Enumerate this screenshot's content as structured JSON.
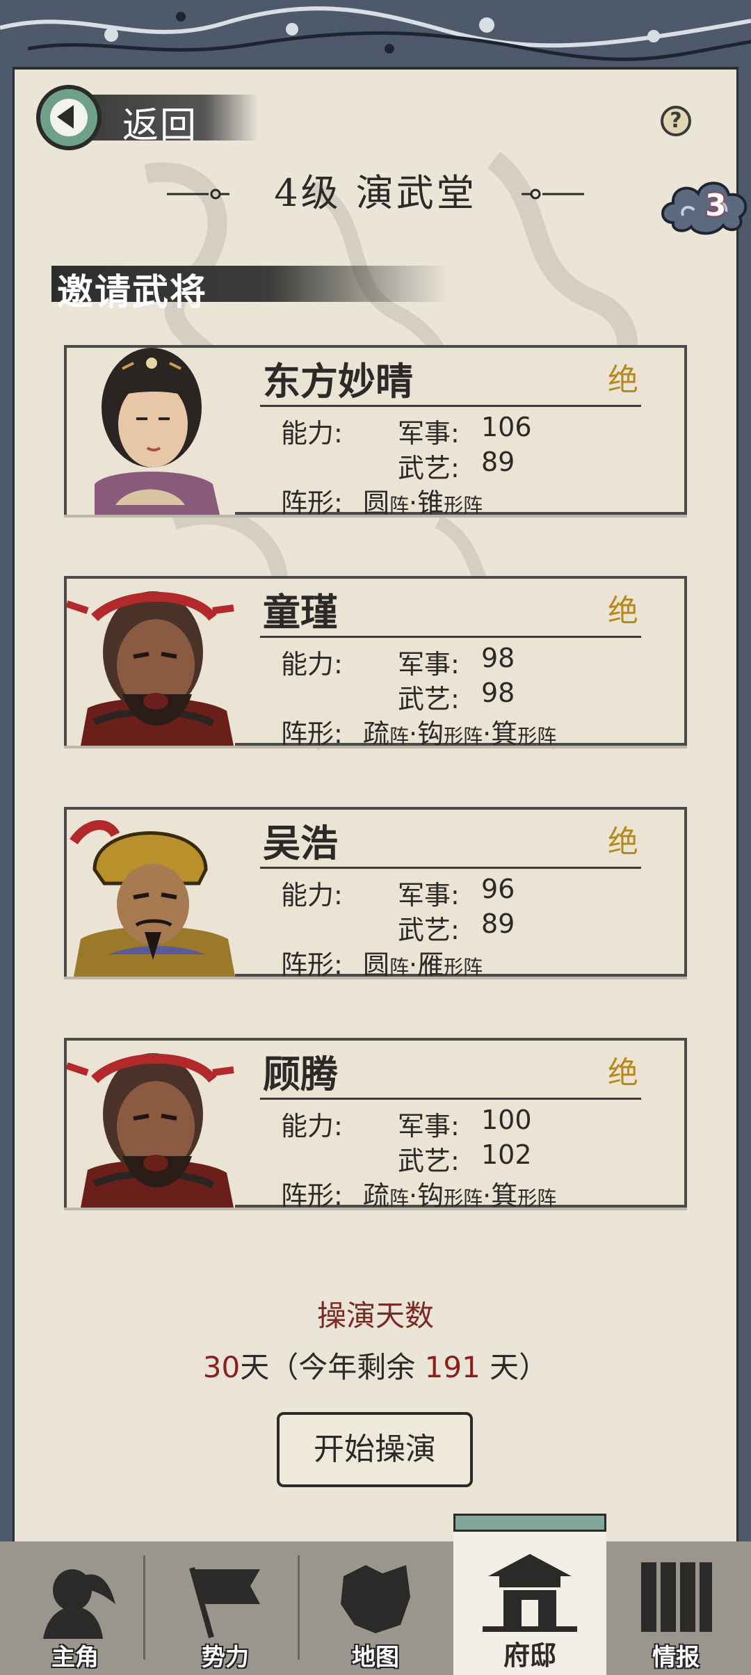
{
  "header": {
    "back_label": "返回",
    "title": "4级 演武堂",
    "badge_count": "3"
  },
  "section": {
    "title": "邀请武将"
  },
  "generals": [
    {
      "name": "东方妙晴",
      "rank": "绝",
      "ability_label": "能力:",
      "military_label": "军事:",
      "military": "106",
      "martial_label": "武艺:",
      "martial": "89",
      "formation_label": "阵形:",
      "formations": [
        {
          "name": "圆",
          "suffix": "阵"
        },
        {
          "name": "锥",
          "suffix": "形阵"
        }
      ]
    },
    {
      "name": "童瑾",
      "rank": "绝",
      "ability_label": "能力:",
      "military_label": "军事:",
      "military": "98",
      "martial_label": "武艺:",
      "martial": "98",
      "formation_label": "阵形:",
      "formations": [
        {
          "name": "疏",
          "suffix": "阵"
        },
        {
          "name": "钩",
          "suffix": "形阵"
        },
        {
          "name": "箕",
          "suffix": "形阵"
        }
      ]
    },
    {
      "name": "吴浩",
      "rank": "绝",
      "ability_label": "能力:",
      "military_label": "军事:",
      "military": "96",
      "martial_label": "武艺:",
      "martial": "89",
      "formation_label": "阵形:",
      "formations": [
        {
          "name": "圆",
          "suffix": "阵"
        },
        {
          "name": "雁",
          "suffix": "形阵"
        }
      ]
    },
    {
      "name": "顾腾",
      "rank": "绝",
      "ability_label": "能力:",
      "military_label": "军事:",
      "military": "100",
      "martial_label": "武艺:",
      "martial": "102",
      "formation_label": "阵形:",
      "formations": [
        {
          "name": "疏",
          "suffix": "阵"
        },
        {
          "name": "钩",
          "suffix": "形阵"
        },
        {
          "name": "箕",
          "suffix": "形阵"
        }
      ]
    }
  ],
  "drill": {
    "label": "操演天数",
    "days": "30",
    "days_unit": "天",
    "remaining_prefix": "（今年剩余",
    "remaining": "191",
    "remaining_suffix": "天）",
    "start_button": "开始操演"
  },
  "nav": [
    {
      "label": "主角",
      "icon": "hero-icon"
    },
    {
      "label": "势力",
      "icon": "flag-icon"
    },
    {
      "label": "地图",
      "icon": "map-icon"
    },
    {
      "label": "府邸",
      "icon": "mansion-icon",
      "active": true
    },
    {
      "label": "情报",
      "icon": "scroll-icon"
    }
  ],
  "colors": {
    "paper": "#ebe5d8",
    "frame": "#4e5a6b",
    "rank_gold": "#b58a1c",
    "accent_red": "#8c1f1a",
    "teal": "#6fa08a"
  }
}
